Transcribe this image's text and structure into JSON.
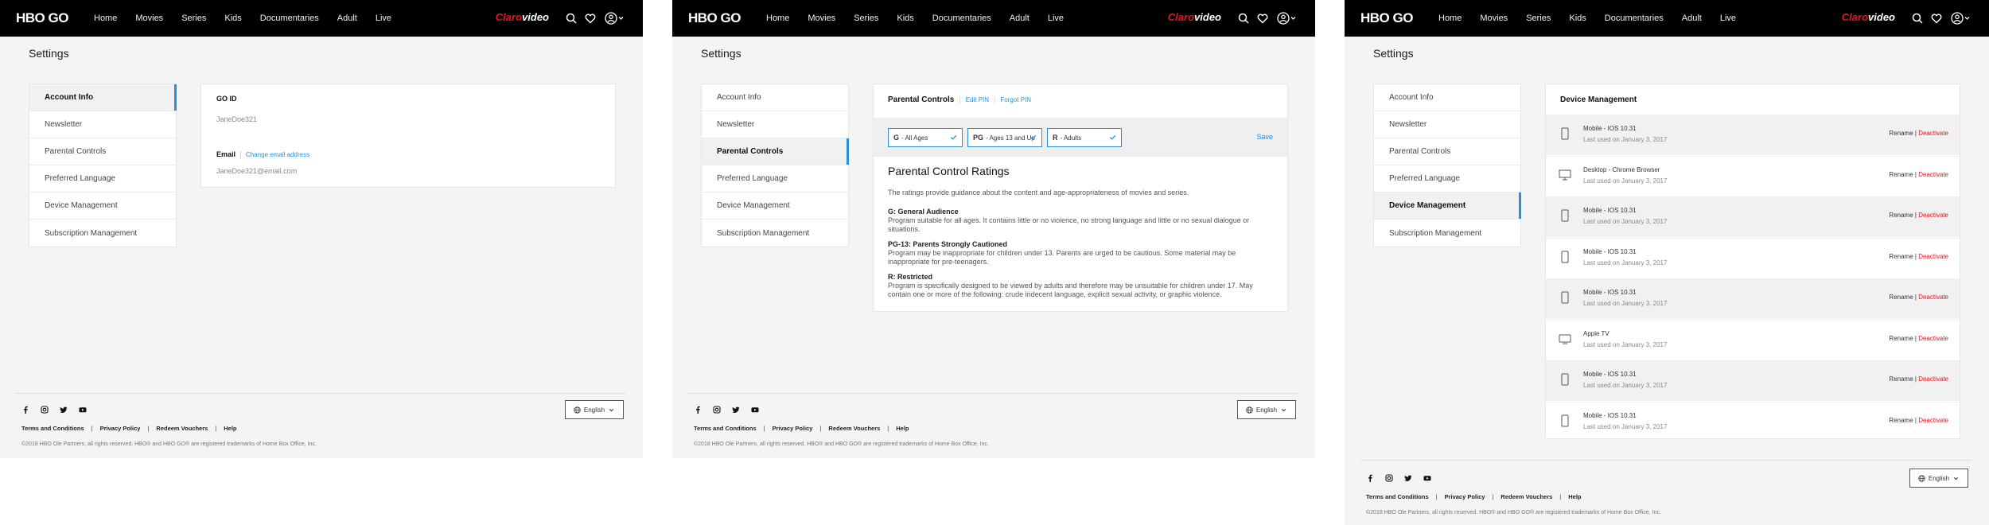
{
  "nav": {
    "logo": "HBO GO",
    "items": [
      "Home",
      "Movies",
      "Series",
      "Kids",
      "Documentaries",
      "Adult",
      "Live"
    ],
    "brand_red": "Claro",
    "brand_white": "video"
  },
  "settings_title": "Settings",
  "sidebar_items": [
    "Account Info",
    "Newsletter",
    "Parental Controls",
    "Preferred Language",
    "Device Management",
    "Subscription Management"
  ],
  "account": {
    "go_id_label": "GO ID",
    "go_id_value": "JaneDoe321",
    "email_label": "Email",
    "change_email_link": "Change email address",
    "email_value": "JaneDoe321@email.com"
  },
  "parental": {
    "title": "Parental Controls",
    "edit_pin": "Edit PIN",
    "forgot_pin": "Forgot PIN",
    "ratings": [
      {
        "code": "G",
        "label": "- All Ages"
      },
      {
        "code": "PG",
        "label": "- Ages 13 and Up"
      },
      {
        "code": "R",
        "label": "- Adults"
      }
    ],
    "save": "Save",
    "heading": "Parental Control Ratings",
    "intro": "The ratings provide guidance about the content and age-appropriateness of movies and series.",
    "definitions": [
      {
        "title": "G: General Audience",
        "text": "Program suitable for all ages. It contains little or no violence, no strong language and little or no sexual dialogue or situations."
      },
      {
        "title": "PG-13: Parents Strongly Cautioned",
        "text": "Program may be inappropriate for children under 13. Parents are urged to be cautious. Some material may be inappropriate for pre-teenagers."
      },
      {
        "title": "R: Restricted",
        "text": "Program is specifically designed to be viewed by adults and therefore may be unsuitable for children under 17. May contain one or more of the following: crude indecent language, explicit sexual activity, or graphic violence."
      }
    ]
  },
  "devices": {
    "title": "Device Management",
    "rename": "Rename",
    "deactivate": "Deactivate",
    "list": [
      {
        "name": "Mobile - IOS 10.31",
        "last": "Last used on January 3, 2017",
        "icon": "phone-icon"
      },
      {
        "name": "Desktop - Chrome Browser",
        "last": "Last used on January 3, 2017",
        "icon": "desktop-icon"
      },
      {
        "name": "Mobile - IOS 10.31",
        "last": "Last used on January 3, 2017",
        "icon": "phone-icon"
      },
      {
        "name": "Mobile - IOS 10.31",
        "last": "Last used on January 3, 2017",
        "icon": "phone-icon"
      },
      {
        "name": "Mobile - IOS 10.31",
        "last": "Last used on January 3, 2017",
        "icon": "phone-icon"
      },
      {
        "name": "Apple TV",
        "last": "Last used on January 3, 2017",
        "icon": "tv-icon"
      },
      {
        "name": "Mobile - IOS 10.31",
        "last": "Last used on January 3, 2017",
        "icon": "phone-icon"
      },
      {
        "name": "Mobile - IOS 10.31",
        "last": "Last used on January 3, 2017",
        "icon": "phone-icon"
      }
    ]
  },
  "footer": {
    "language": "English",
    "links": [
      "Terms and Conditions",
      "Privacy Policy",
      "Redeem Vouchers",
      "Help"
    ],
    "copyright": "©2018 HBO Ole Partners, all rights reserved. HBO® and HBO GO® are registered trademarks of Home Box Office, Inc."
  },
  "colors": {
    "accent_blue": "#2a8fd8",
    "brand_red": "#e4151f",
    "topbar": "#000000"
  }
}
